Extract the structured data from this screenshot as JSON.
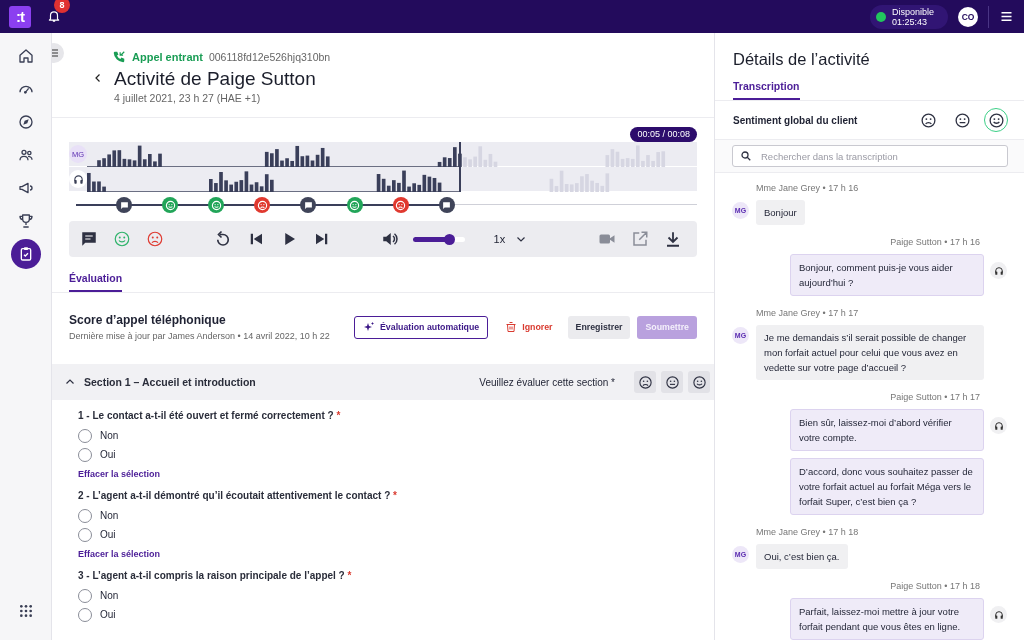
{
  "topbar": {
    "logo": ":t",
    "notifications": "8",
    "status": {
      "label": "Disponible",
      "time": "01:25:43",
      "color": "#22c55e"
    },
    "avatar": "CO"
  },
  "sidebar": {
    "items": [
      {
        "kind": "home",
        "selected": false
      },
      {
        "kind": "gauge",
        "selected": false
      },
      {
        "kind": "compass",
        "selected": false
      },
      {
        "kind": "people",
        "selected": false
      },
      {
        "kind": "megaphone",
        "selected": false
      },
      {
        "kind": "trophy",
        "selected": false
      },
      {
        "kind": "clipboard",
        "selected": true
      }
    ]
  },
  "activity": {
    "call_type": "Appel entrant",
    "call_id": "006118fd12e526hjq310bn",
    "title": "Activité de Paige Sutton",
    "date": "4 juillet 2021, 23 h 27 (HAE +1)"
  },
  "player": {
    "time": "00:05 / 00:08",
    "level": 0.61,
    "tracks": [
      {
        "kind": "initials",
        "label": "MG"
      },
      {
        "kind": "headset"
      }
    ],
    "markers": [
      {
        "kind": "comment"
      },
      {
        "kind": "positive"
      },
      {
        "kind": "positive"
      },
      {
        "kind": "negative"
      },
      {
        "kind": "comment"
      },
      {
        "kind": "positive"
      },
      {
        "kind": "negative"
      },
      {
        "kind": "comment"
      }
    ],
    "volume": {
      "level": 0.7
    },
    "speed": "1x"
  },
  "tabs": [
    {
      "label": "Évaluation",
      "selected": true
    }
  ],
  "form": {
    "title": "Score d’appel téléphonique",
    "updated": "Dernière mise à jour par James Anderson • 14 avril 2022, 10 h 22",
    "buttons": [
      {
        "kind": "auto",
        "label": "Évaluation automatique",
        "disabled": false
      },
      {
        "kind": "danger",
        "label": "Ignorer",
        "disabled": false
      },
      {
        "kind": "secondary",
        "label": "Enregistrer",
        "disabled": false
      },
      {
        "kind": "primary",
        "label": "Soumettre",
        "disabled": true
      }
    ]
  },
  "section": {
    "title": "Section 1 – Accueil et introduction",
    "expanded": true,
    "prompt": "Veuillez évaluer cette section *",
    "ratings": [
      {
        "kind": "negative",
        "selected": false
      },
      {
        "kind": "neutral",
        "selected": false
      },
      {
        "kind": "positive",
        "selected": false
      }
    ],
    "questions": [
      {
        "label": "1 - Le contact a-t-il été ouvert et fermé correctement ?",
        "required_mark": "*",
        "options": [
          {
            "label": "Non",
            "checked": false
          },
          {
            "label": "Oui",
            "checked": false
          }
        ],
        "clear": "Effacer la sélection"
      },
      {
        "label": "2 - L’agent a-t-il démontré qu’il écoutait attentivement le contact ?",
        "required_mark": "*",
        "options": [
          {
            "label": "Non",
            "checked": false
          },
          {
            "label": "Oui",
            "checked": false
          }
        ],
        "clear": "Effacer la sélection"
      },
      {
        "label": "3 - L’agent a-t-il compris la raison principale de l’appel ?",
        "required_mark": "*",
        "options": [
          {
            "label": "Non",
            "checked": false
          },
          {
            "label": "Oui",
            "checked": false
          }
        ]
      }
    ]
  },
  "details": {
    "title": "Détails de l’activité",
    "tabs": [
      {
        "label": "Transcription",
        "selected": true
      }
    ],
    "sentiment": {
      "label": "Sentiment global du client",
      "options": [
        {
          "kind": "negative",
          "selected": false
        },
        {
          "kind": "neutral",
          "selected": false
        },
        {
          "kind": "positive",
          "selected": true
        }
      ]
    },
    "search": {
      "placeholder": "Rechercher dans la transcription"
    },
    "messages": [
      {
        "kind": "customer",
        "meta": "Mme Jane Grey • 17 h 16",
        "initials": "MG",
        "texts": [
          "Bonjour"
        ]
      },
      {
        "kind": "agent",
        "meta": "Paige Sutton • 17 h 16",
        "texts": [
          "Bonjour, comment puis-je vous aider aujourd’hui ?"
        ]
      },
      {
        "kind": "customer",
        "meta": "Mme Jane Grey • 17 h 17",
        "initials": "MG",
        "texts": [
          "Je me demandais s’il serait possible de changer mon forfait actuel pour celui que vous avez en vedette sur votre page d’accueil ?"
        ]
      },
      {
        "kind": "agent",
        "meta": "Paige Sutton • 17 h 17",
        "texts": [
          "Bien sûr, laissez-moi d’abord vérifier votre compte.",
          "D’accord, donc vous souhaitez passer de votre forfait actuel au forfait Méga vers le forfait Super, c’est bien ça ?"
        ]
      },
      {
        "kind": "customer",
        "meta": "Mme Jane Grey • 17 h 18",
        "initials": "MG",
        "texts": [
          "Oui, c’est bien ça."
        ]
      },
      {
        "kind": "agent",
        "meta": "Paige Sutton • 17 h 18",
        "texts": [
          "Parfait, laissez-moi mettre à jour votre forfait pendant que vous êtes en ligne."
        ]
      }
    ]
  }
}
